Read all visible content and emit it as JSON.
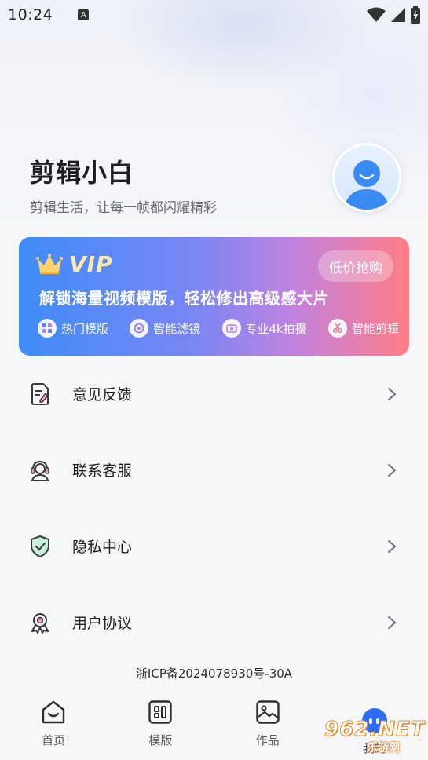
{
  "status_bar": {
    "time": "10:24",
    "notification_icon_text": "A"
  },
  "profile": {
    "username": "剪辑小白",
    "tagline": "剪辑生活，让每一帧都闪耀精彩"
  },
  "vip": {
    "label": "VIP",
    "buy_button": "低价抢购",
    "headline": "解锁海量视频模版，轻松修出高级感大片",
    "features": [
      {
        "icon": "template-icon",
        "label": "热门模版"
      },
      {
        "icon": "filter-icon",
        "label": "智能滤镜"
      },
      {
        "icon": "camera-icon",
        "label": "专业4k拍摄"
      },
      {
        "icon": "scissors-icon",
        "label": "智能剪辑"
      }
    ]
  },
  "menu": [
    {
      "icon": "feedback-icon",
      "label": "意见反馈"
    },
    {
      "icon": "customer-service-icon",
      "label": "联系客服"
    },
    {
      "icon": "shield-icon",
      "label": "隐私中心"
    },
    {
      "icon": "agreement-icon",
      "label": "用户协议"
    }
  ],
  "icp": "浙ICP备2024078930号-30A",
  "tabbar": {
    "tabs": [
      {
        "icon": "home-icon",
        "label": "首页"
      },
      {
        "icon": "template-grid-icon",
        "label": "模版"
      },
      {
        "icon": "works-icon",
        "label": "作品"
      },
      {
        "icon": "profile-face-icon",
        "label": "我的"
      }
    ]
  },
  "watermark": {
    "main": "962.NET",
    "sub": "乐游网"
  },
  "colors": {
    "accent": "#2e6cf6",
    "vip_start": "#3f8cf8",
    "vip_end": "#ff7d86"
  }
}
